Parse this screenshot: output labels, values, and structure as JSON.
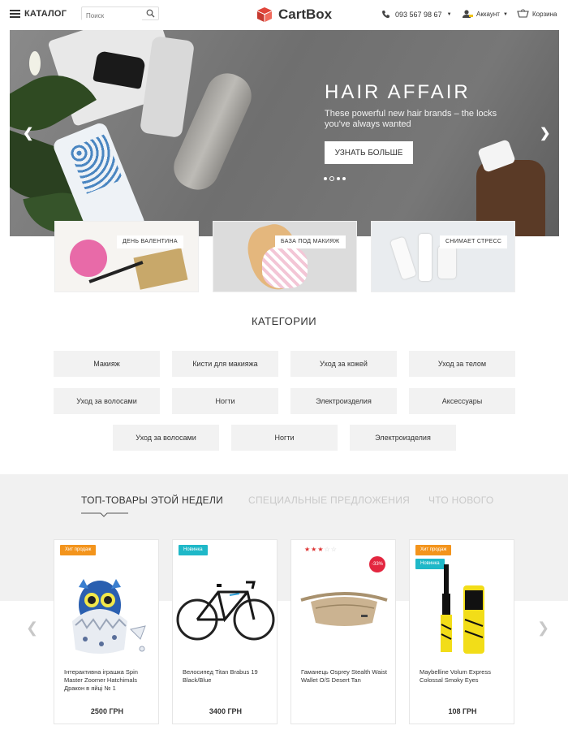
{
  "header": {
    "catalog_label": "КАТАЛОГ",
    "search_placeholder": "Поиск",
    "logo_text": "CartBox",
    "phone": "093 567 98 67",
    "account_label": "Аккаунт",
    "cart_label": "Корзина"
  },
  "hero": {
    "title": "HAIR AFFAIR",
    "subtitle": "These powerful new hair brands – the locks you've always wanted",
    "button_label": "УЗНАТЬ БОЛЬШЕ"
  },
  "promos": [
    {
      "label": "ДЕНЬ ВАЛЕНТИНА"
    },
    {
      "label": "БАЗА ПОД МАКИЯЖ"
    },
    {
      "label": "СНИМАЕТ СТРЕСС"
    }
  ],
  "categories": {
    "title": "КАТЕГОРИИ",
    "items": [
      "Макияж",
      "Кисти для макияжа",
      "Уход за кожей",
      "Уход за телом",
      "Уход за волосами",
      "Ногти",
      "Электроизделия",
      "Аксессуары",
      "Уход за волосами",
      "Ногти",
      "Электроизделия"
    ]
  },
  "tabs": [
    "ТОП-ТОВАРЫ ЭТОЙ НЕДЕЛИ",
    "СПЕЦИАЛЬНЫЕ ПРЕДЛОЖЕНИЯ",
    "ЧТО НОВОГО"
  ],
  "products": [
    {
      "badge": "Хит продаж",
      "name": "Інтерактивна іграшка Spin Master Zoomer Hatchimals Дракон в яйці № 1",
      "price": "2500 ГРН"
    },
    {
      "badge": "Новинка",
      "name": "Велосипед Titan Brabus 19 Black/Blue",
      "price": "3400 ГРН"
    },
    {
      "discount": "-33%",
      "rating": 3,
      "name": "Гаманець Osprey Stealth Waist Wallet O/S Desert Tan",
      "price": ""
    },
    {
      "badge": "Хит продаж",
      "badge2": "Новинка",
      "name": "Maybelline Volum Express Colossal Smoky Eyes",
      "price": "108 ГРН"
    }
  ],
  "colors": {
    "badge_orange": "#f3941c",
    "badge_teal": "#1fb8c8",
    "discount_red": "#e3263f",
    "logo_red": "#e0453a"
  }
}
